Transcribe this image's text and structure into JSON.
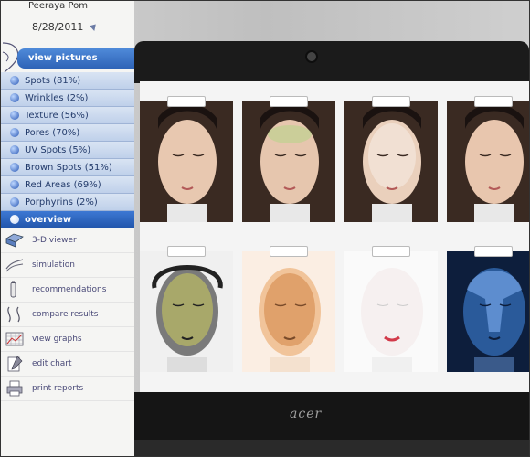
{
  "user": {
    "name": "Peeraya Pom",
    "date": "8/28/2011"
  },
  "nav": {
    "header": "view pictures",
    "items": [
      {
        "label": "Spots (81%)"
      },
      {
        "label": "Wrinkles (2%)"
      },
      {
        "label": "Texture (56%)"
      },
      {
        "label": "Pores (70%)"
      },
      {
        "label": "UV Spots (5%)"
      },
      {
        "label": "Brown Spots (51%)"
      },
      {
        "label": "Red Areas (69%)"
      },
      {
        "label": "Porphyrins (2%)"
      },
      {
        "label": "overview"
      }
    ]
  },
  "tools": [
    {
      "label": "3-D viewer",
      "icon": "3d-viewer-icon"
    },
    {
      "label": "simulation",
      "icon": "simulation-icon"
    },
    {
      "label": "recommendations",
      "icon": "recommendations-icon"
    },
    {
      "label": "compare results",
      "icon": "compare-icon"
    },
    {
      "label": "view graphs",
      "icon": "graph-icon"
    },
    {
      "label": "edit chart",
      "icon": "edit-chart-icon"
    },
    {
      "label": "print reports",
      "icon": "print-icon"
    }
  ],
  "monitor": {
    "brand": "acer"
  },
  "colors": {
    "accent": "#2e63b7",
    "menu_bg": "#c9d8ee"
  }
}
